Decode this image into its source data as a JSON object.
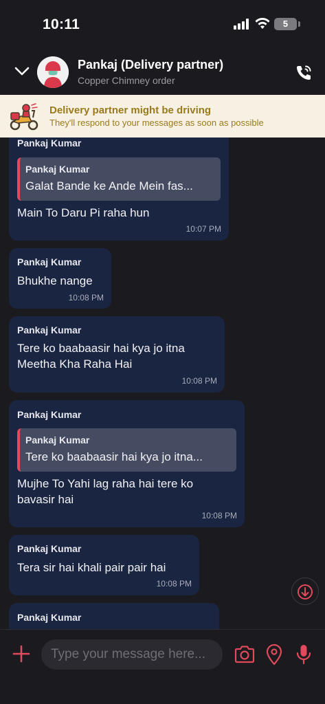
{
  "status_bar": {
    "time": "10:11",
    "battery": "5"
  },
  "header": {
    "name": "Pankaj (Delivery partner)",
    "subtitle": "Copper Chimney order"
  },
  "banner": {
    "title": "Delivery partner might be driving",
    "subtitle": "They'll respond to your messages as soon as possible"
  },
  "messages": [
    {
      "sender": "Pankaj Kumar",
      "quote": {
        "sender": "Pankaj Kumar",
        "text": "Galat Bande ke Ande Mein fas..."
      },
      "text": "Main To Daru Pi raha hun",
      "time": "10:07 PM"
    },
    {
      "sender": "Pankaj Kumar",
      "text": "Bhukhe nange",
      "time": "10:08 PM"
    },
    {
      "sender": "Pankaj Kumar",
      "text": "Tere ko baabaasir hai kya jo itna Meetha Kha Raha Hai",
      "time": "10:08 PM"
    },
    {
      "sender": "Pankaj Kumar",
      "quote": {
        "sender": "Pankaj Kumar",
        "text": "Tere ko baabaasir hai kya jo itna..."
      },
      "text": "Mujhe To Yahi lag raha hai tere ko bavasir hai",
      "time": "10:08 PM"
    },
    {
      "sender": "Pankaj Kumar",
      "text": "Tera sir hai khali pair pair hai",
      "time": "10:08 PM"
    },
    {
      "sender": "Pankaj Kumar"
    }
  ],
  "composer": {
    "placeholder": "Type your message here..."
  },
  "colors": {
    "bubble": "#1a2541",
    "accent": "#e04a5a",
    "banner_bg": "#f6f1e3",
    "banner_text": "#9a7a1c"
  }
}
